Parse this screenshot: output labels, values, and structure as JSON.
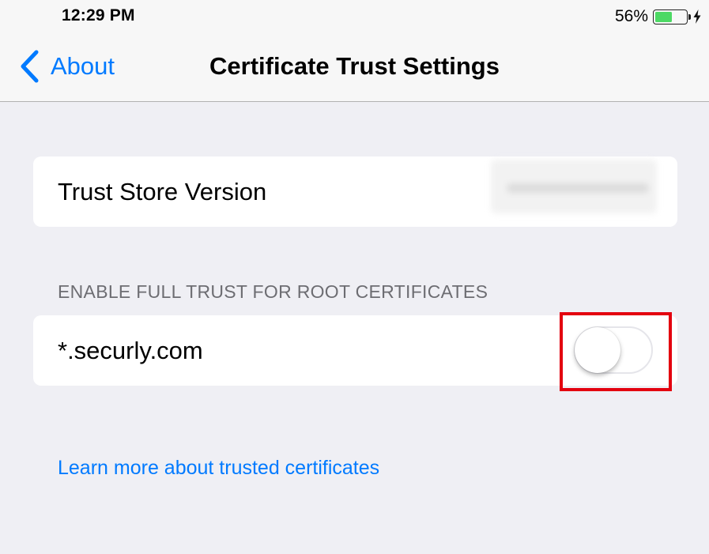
{
  "status_bar": {
    "time": "12:29 PM",
    "battery_percent": "56%",
    "battery_level": 0.56,
    "battery_color": "#4cd964",
    "charging_icon": "bolt-icon"
  },
  "nav": {
    "back_label": "About",
    "back_icon": "chevron-left-icon",
    "title": "Certificate Trust Settings"
  },
  "trust_store": {
    "label": "Trust Store Version",
    "value": ""
  },
  "root_certs": {
    "section_header": "ENABLE FULL TRUST FOR ROOT CERTIFICATES",
    "items": [
      {
        "label": "*.securly.com",
        "enabled": false
      }
    ]
  },
  "footer": {
    "learn_more_link": "Learn more about trusted certificates"
  },
  "colors": {
    "accent": "#007aff",
    "highlight": "#e3000f",
    "background": "#efeff4"
  }
}
